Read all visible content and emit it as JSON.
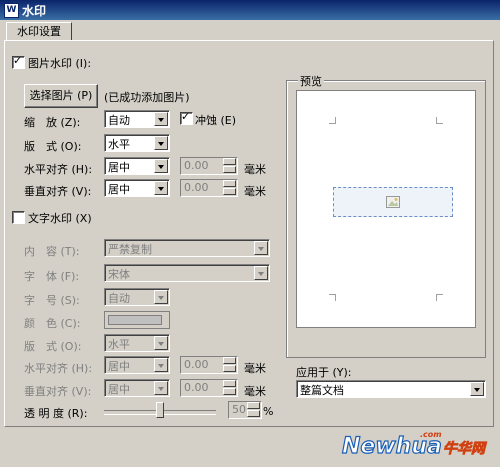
{
  "window": {
    "title": "水印",
    "icon": "wps-app-icon"
  },
  "tabs": [
    {
      "label": "水印设置"
    }
  ],
  "picture": {
    "checkbox_label": "图片水印 (I):",
    "checked": true,
    "select_button": "选择图片 (P)",
    "status": "(已成功添加图片)",
    "scale_label": "缩　放 (Z):",
    "scale_value": "自动",
    "washout_label": "冲蚀 (E)",
    "washout_checked": true,
    "layout_label": "版　式 (O):",
    "layout_value": "水平",
    "halign_label": "水平对齐 (H):",
    "halign_value": "居中",
    "halign_offset": "0.00",
    "valign_label": "垂直对齐 (V):",
    "valign_value": "居中",
    "valign_offset": "0.00",
    "unit": "毫米"
  },
  "text": {
    "checkbox_label": "文字水印 (X)",
    "checked": false,
    "content_label": "内　容 (T):",
    "content_value": "严禁复制",
    "font_label": "字　体 (F):",
    "font_value": "宋体",
    "size_label": "字　号 (S):",
    "size_value": "自动",
    "color_label": "颜　色 (C):",
    "layout_label": "版　式 (O):",
    "layout_value": "水平",
    "halign_label": "水平对齐 (H):",
    "halign_value": "居中",
    "halign_offset": "0.00",
    "valign_label": "垂直对齐 (V):",
    "valign_value": "居中",
    "valign_offset": "0.00",
    "unit": "毫米",
    "transparency_label": "透 明 度 (R):",
    "transparency_value": "50",
    "transparency_unit": "%"
  },
  "preview": {
    "label": "预览"
  },
  "apply": {
    "label": "应用于 (Y):",
    "value": "整篇文档"
  },
  "watermark_logo": {
    "text": "Newhua",
    "domain": ".com",
    "suffix": "牛华网"
  },
  "colors": {
    "titlebar": "#0a246a",
    "dialog": "#d4d0c8",
    "wm_border": "#6a8fc8"
  }
}
